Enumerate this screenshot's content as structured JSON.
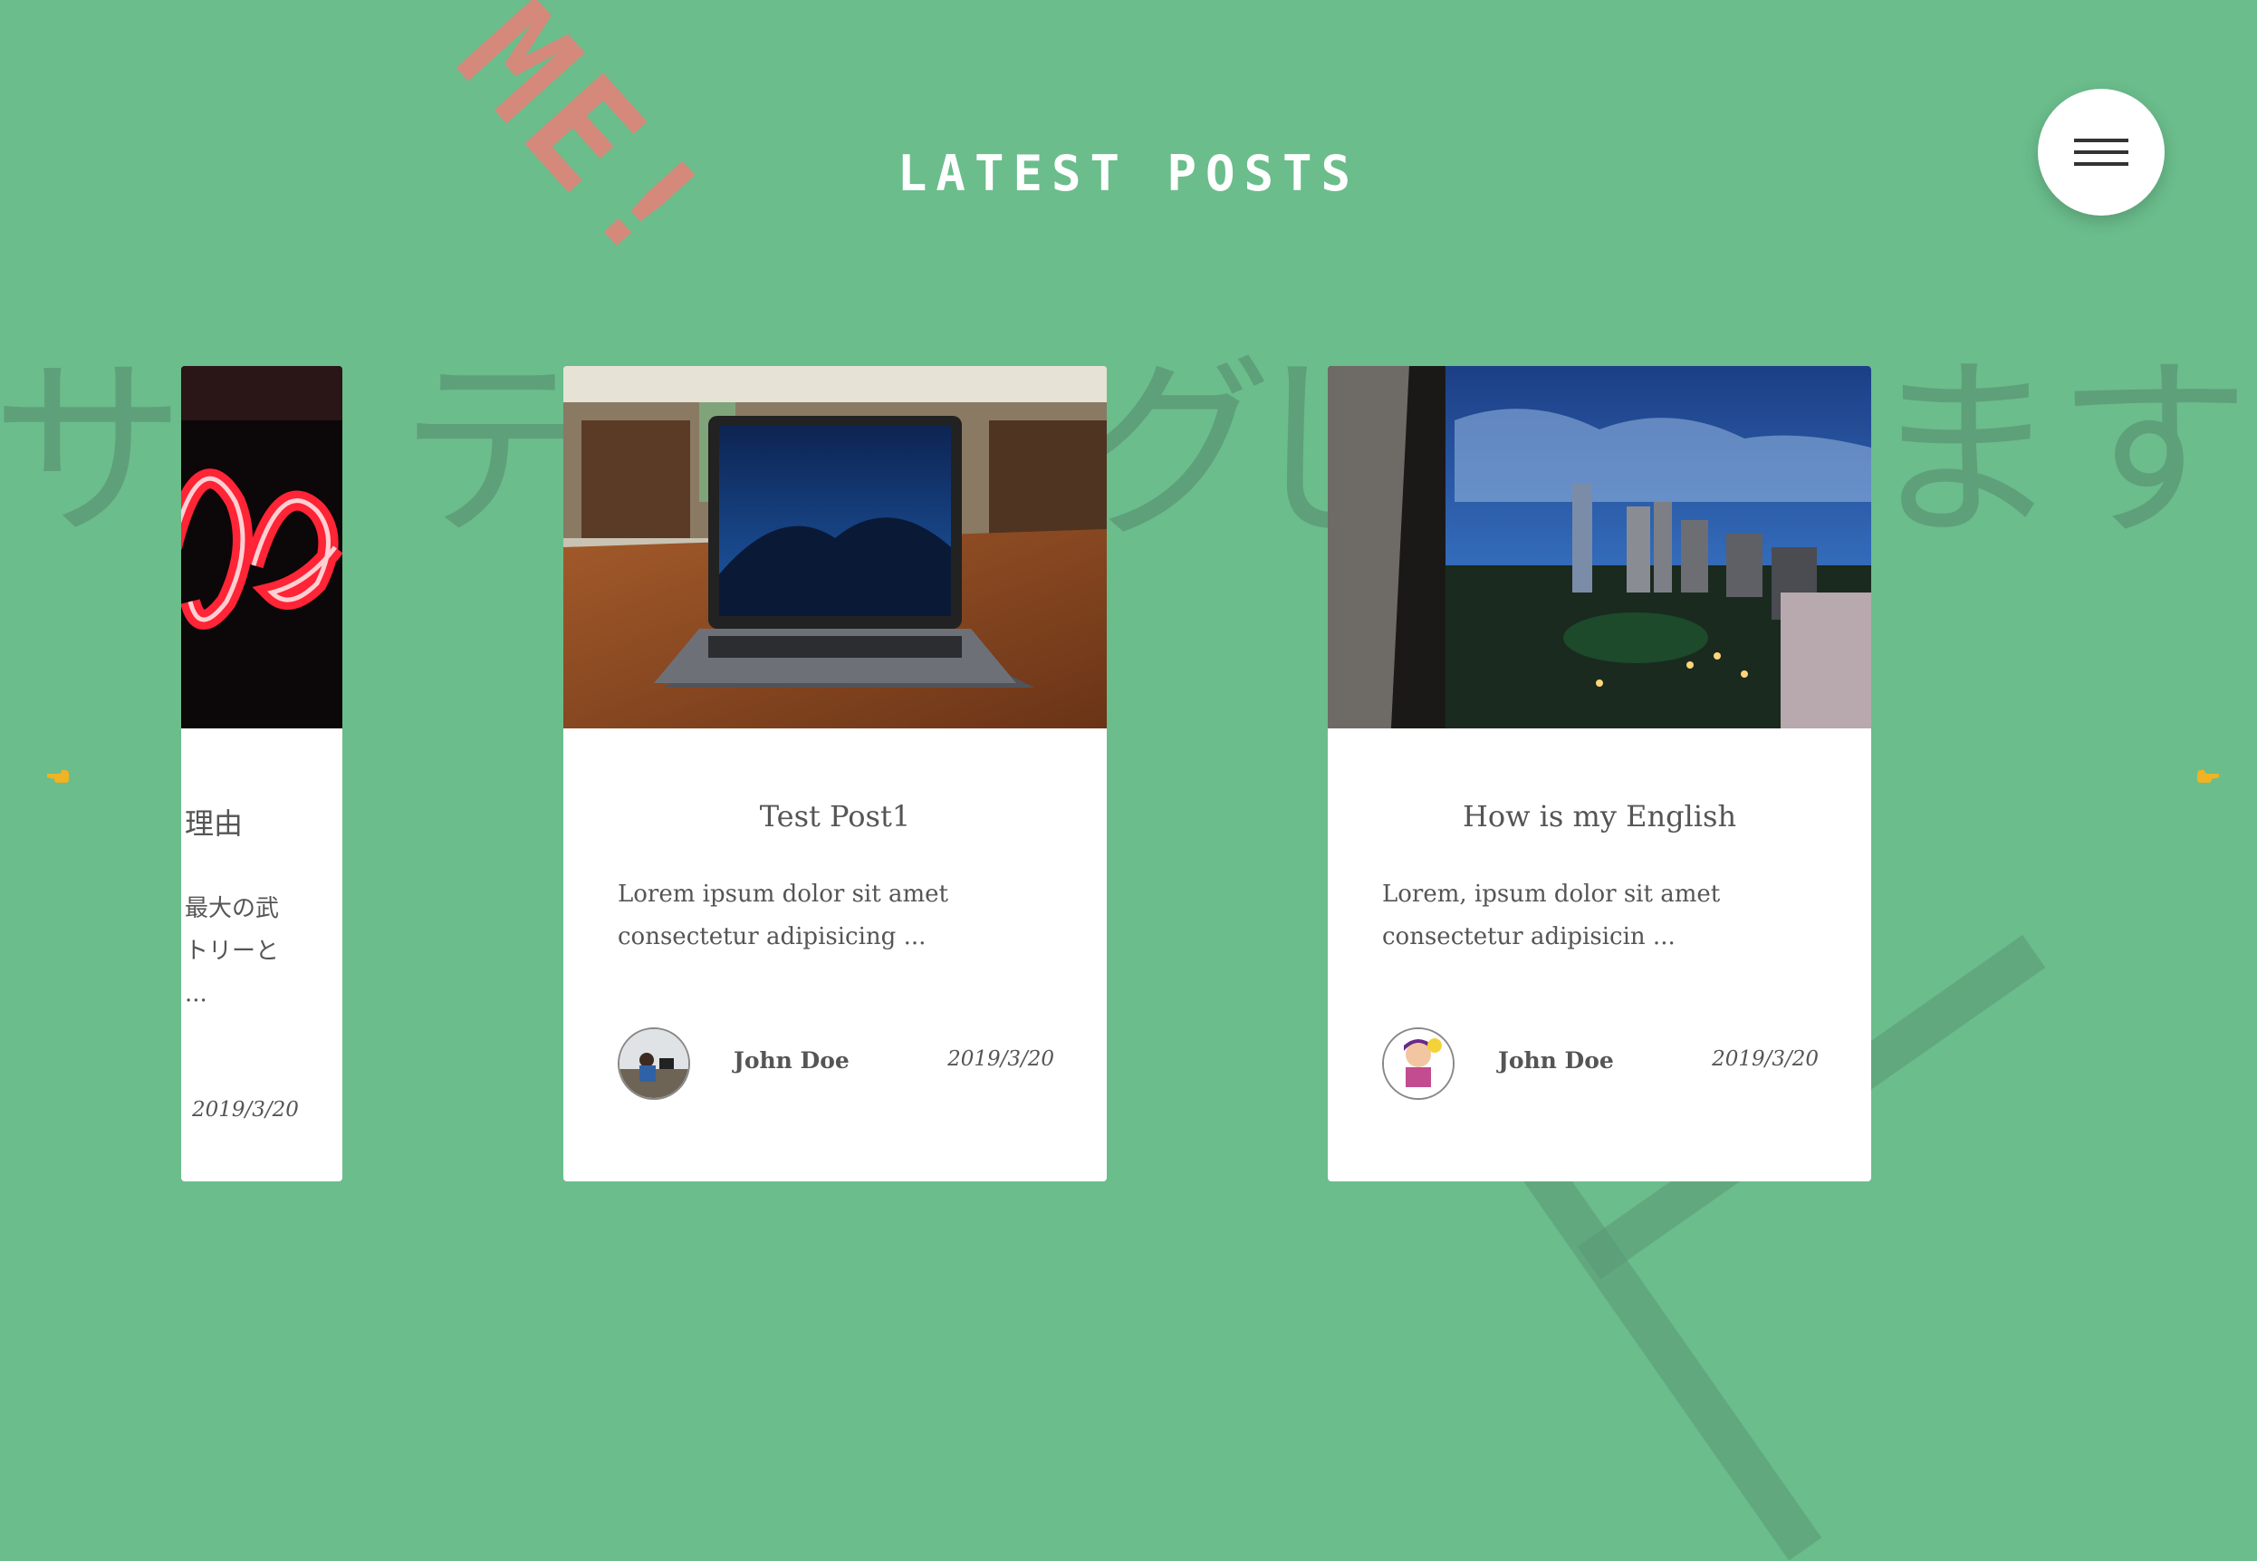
{
  "page": {
    "title": "LATEST POSTS",
    "background": "#6bbd8c"
  },
  "background_text": {
    "chars": [
      "サ",
      "テ",
      "グ",
      "し",
      "ま",
      "す"
    ],
    "stamp": "ME!"
  },
  "menu": {
    "icon": "hamburger-menu-icon"
  },
  "nav": {
    "prev_icon": "pointing-hand-left-icon",
    "next_icon": "pointing-hand-right-icon"
  },
  "posts": [
    {
      "title": "理由",
      "excerpt_lines": [
        "最大の武",
        "トリーと",
        "..."
      ],
      "date": "2019/3/20",
      "image": "neon-sign-photo"
    },
    {
      "title": "Test Post1",
      "excerpt": "Lorem ipsum dolor sit amet consectetur adipisicing ...",
      "author": "John Doe",
      "date": "2019/3/20",
      "image": "laptop-on-table-photo",
      "avatar": "person-at-desk-avatar"
    },
    {
      "title": "How is my English",
      "excerpt": "Lorem, ipsum dolor sit amet consectetur adipisicin ...",
      "author": "John Doe",
      "date": "2019/3/20",
      "image": "city-night-skyline-photo",
      "avatar": "cartoon-character-avatar"
    }
  ]
}
